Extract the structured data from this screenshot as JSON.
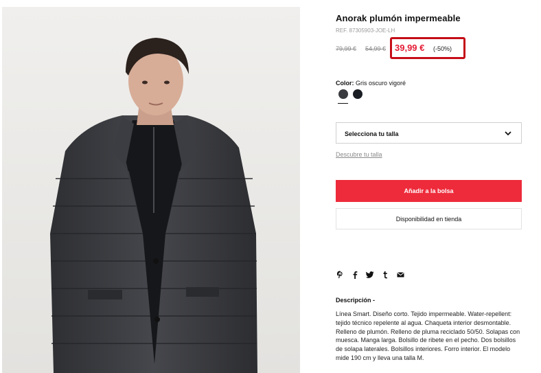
{
  "product": {
    "title": "Anorak plumón impermeable",
    "ref": "REF. 87305903-JOE-LH",
    "old_price_1": "79,99 €",
    "old_price_2": "54,99 €",
    "price": "39,99 €",
    "discount": "(-50%)"
  },
  "color": {
    "label": "Color:",
    "value": "Gris oscuro vigoré",
    "swatches": [
      "#3a3b3f",
      "#1b1d24"
    ]
  },
  "size": {
    "select_label": "Selecciona tu talla",
    "guide_link": "Descubre tu talla"
  },
  "buttons": {
    "add_to_bag": "Añadir a la bolsa",
    "store_availability": "Disponibilidad en tienda"
  },
  "share_icons": [
    "pinterest-icon",
    "facebook-icon",
    "twitter-icon",
    "tumblr-icon",
    "email-icon"
  ],
  "description": {
    "heading": "Descripción -",
    "text": "Línea Smart. Diseño corto. Tejido impermeable. Water-repellent: tejido técnico repelente al agua. Chaqueta interior desmontable. Relleno de plumón. Relleno de pluma reciclado 50/50. Solapas con muesca. Manga larga. Bolsillo de ribete en el pecho. Dos bolsillos de solapa laterales. Bolsillos interiores. Forro interior. El modelo mide 190 cm y lleva una talla M."
  },
  "colors": {
    "accent": "#ee2b3b",
    "highlight_box": "#c50d18",
    "price": "#e41b33"
  }
}
